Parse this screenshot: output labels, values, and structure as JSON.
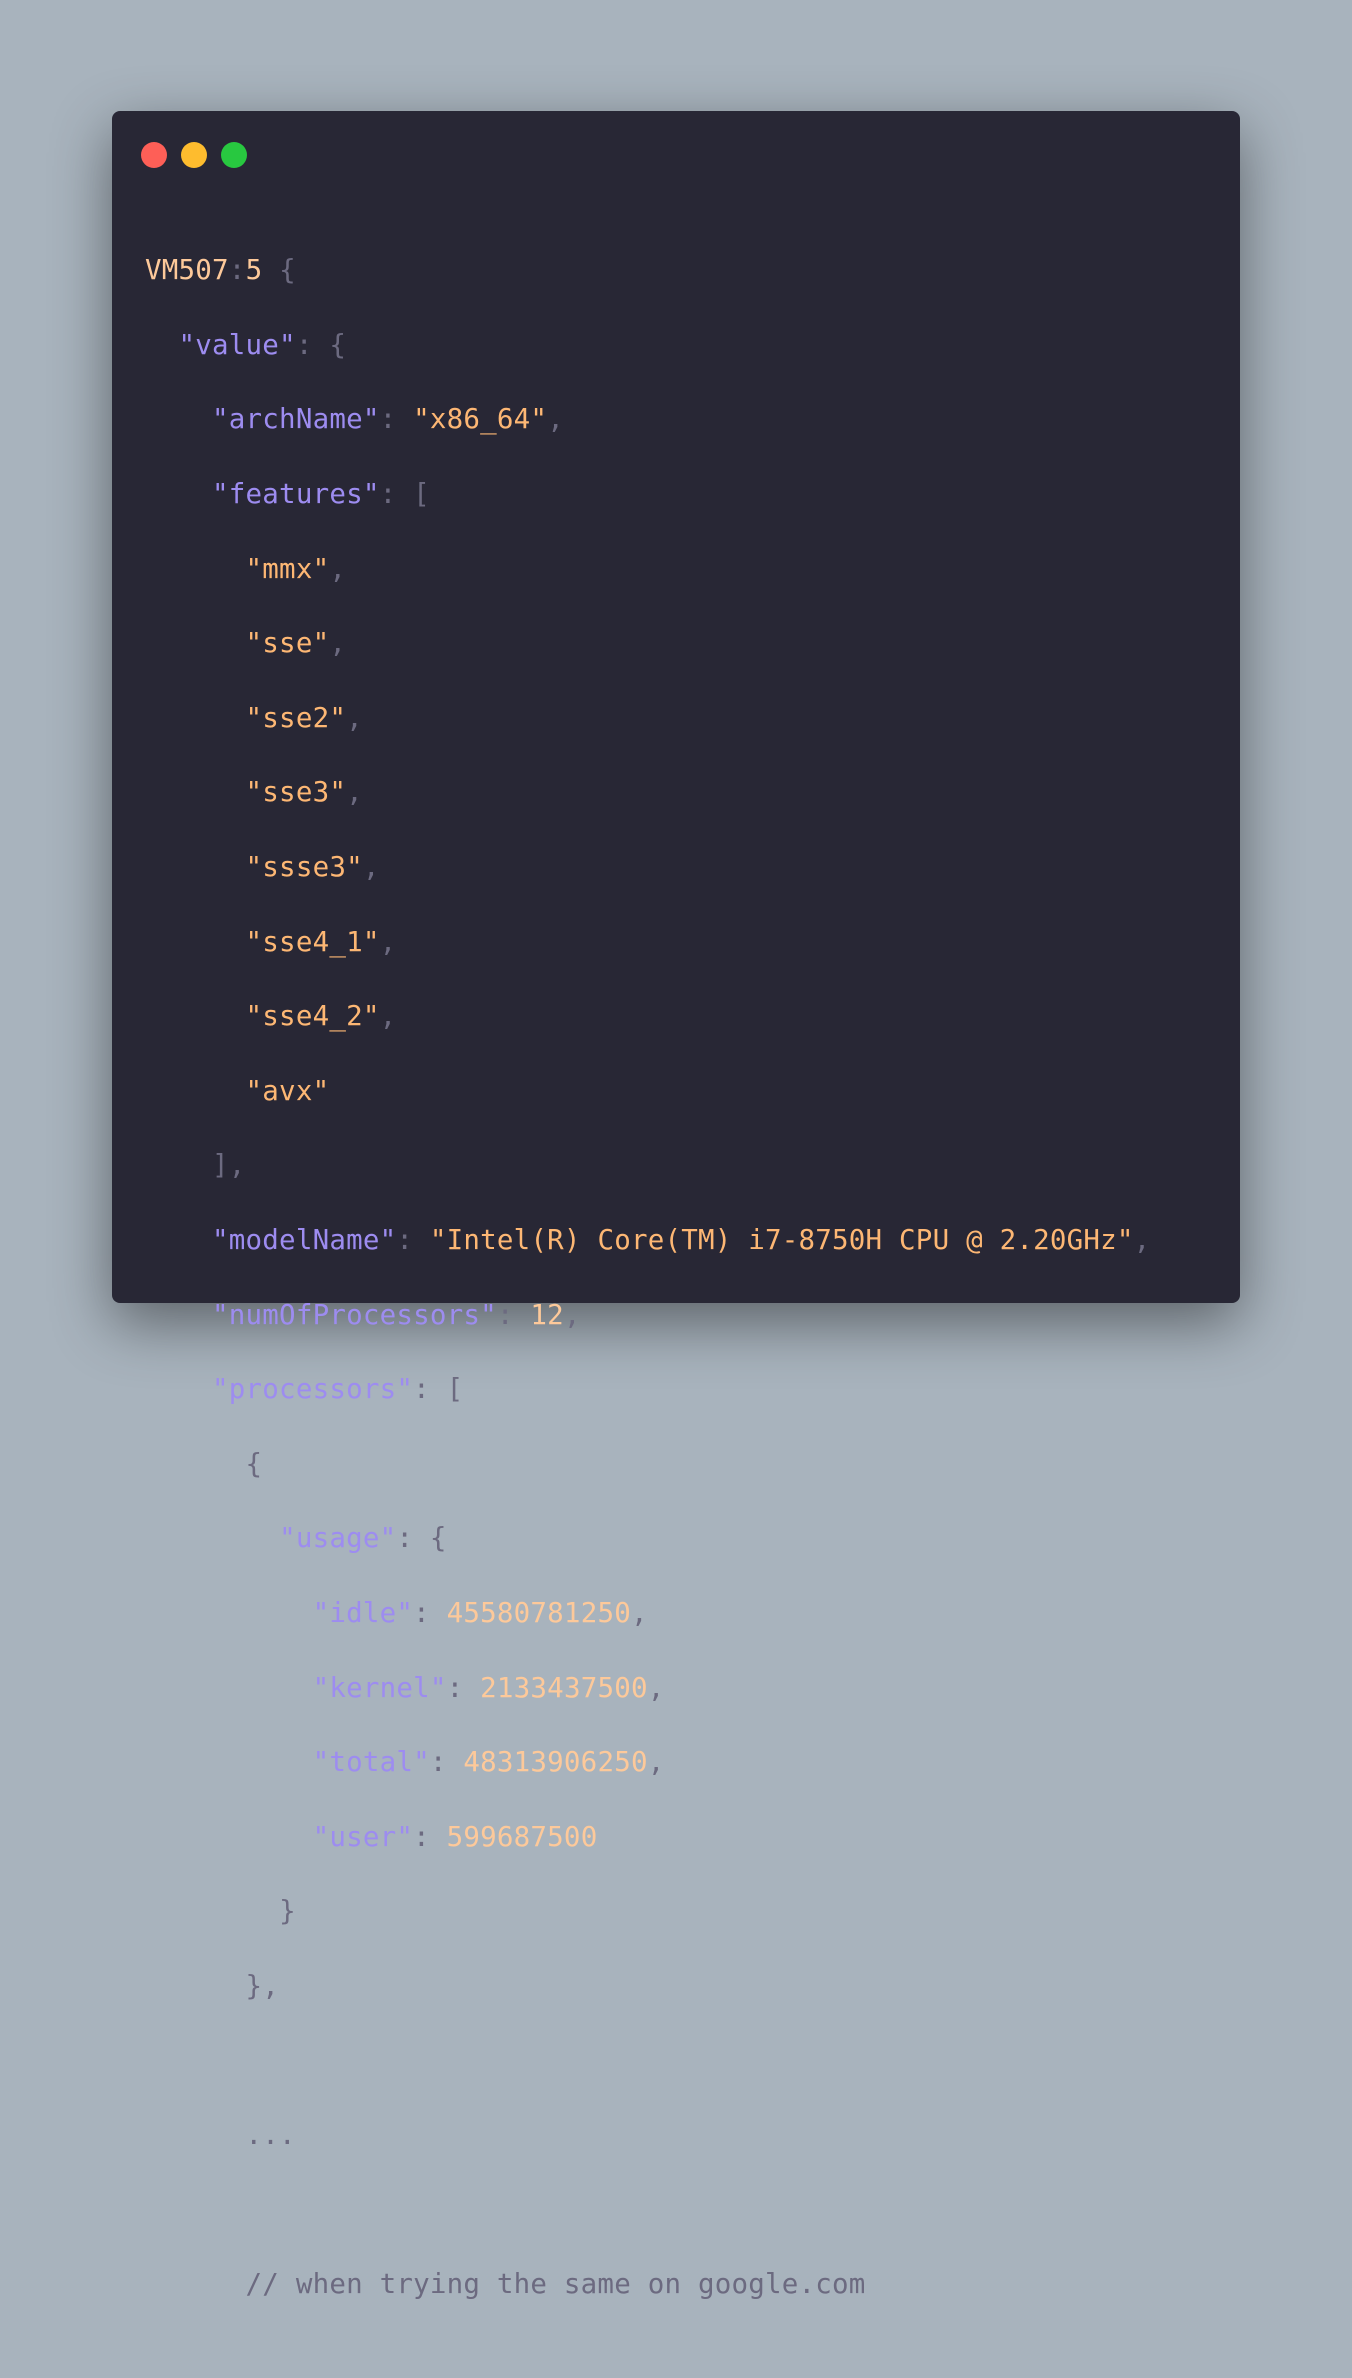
{
  "window": {
    "controls": [
      "close",
      "minimize",
      "maximize"
    ],
    "colors": {
      "close": "#fe5f57",
      "minimize": "#febc2e",
      "maximize": "#28c840",
      "background": "#282735"
    }
  },
  "code": {
    "source_label": "VM507",
    "source_line": "5",
    "value_key": "\"value\"",
    "archName_key": "\"archName\"",
    "archName_value": "\"x86_64\"",
    "features_key": "\"features\"",
    "features": [
      "\"mmx\"",
      "\"sse\"",
      "\"sse2\"",
      "\"sse3\"",
      "\"ssse3\"",
      "\"sse4_1\"",
      "\"sse4_2\"",
      "\"avx\""
    ],
    "modelName_key": "\"modelName\"",
    "modelName_value": "\"Intel(R) Core(TM) i7-8750H CPU @ 2.20GHz\"",
    "numOfProcessors_key": "\"numOfProcessors\"",
    "numOfProcessors_value": "12",
    "processors_key": "\"processors\"",
    "usage_key": "\"usage\"",
    "idle_key": "\"idle\"",
    "idle_value": "45580781250",
    "kernel_key": "\"kernel\"",
    "kernel_value": "2133437500",
    "total_key": "\"total\"",
    "total_value": "48313906250",
    "user_key": "\"user\"",
    "user_value": "599687500",
    "ellipsis": "...",
    "comment": "// when trying the same on google.com"
  }
}
